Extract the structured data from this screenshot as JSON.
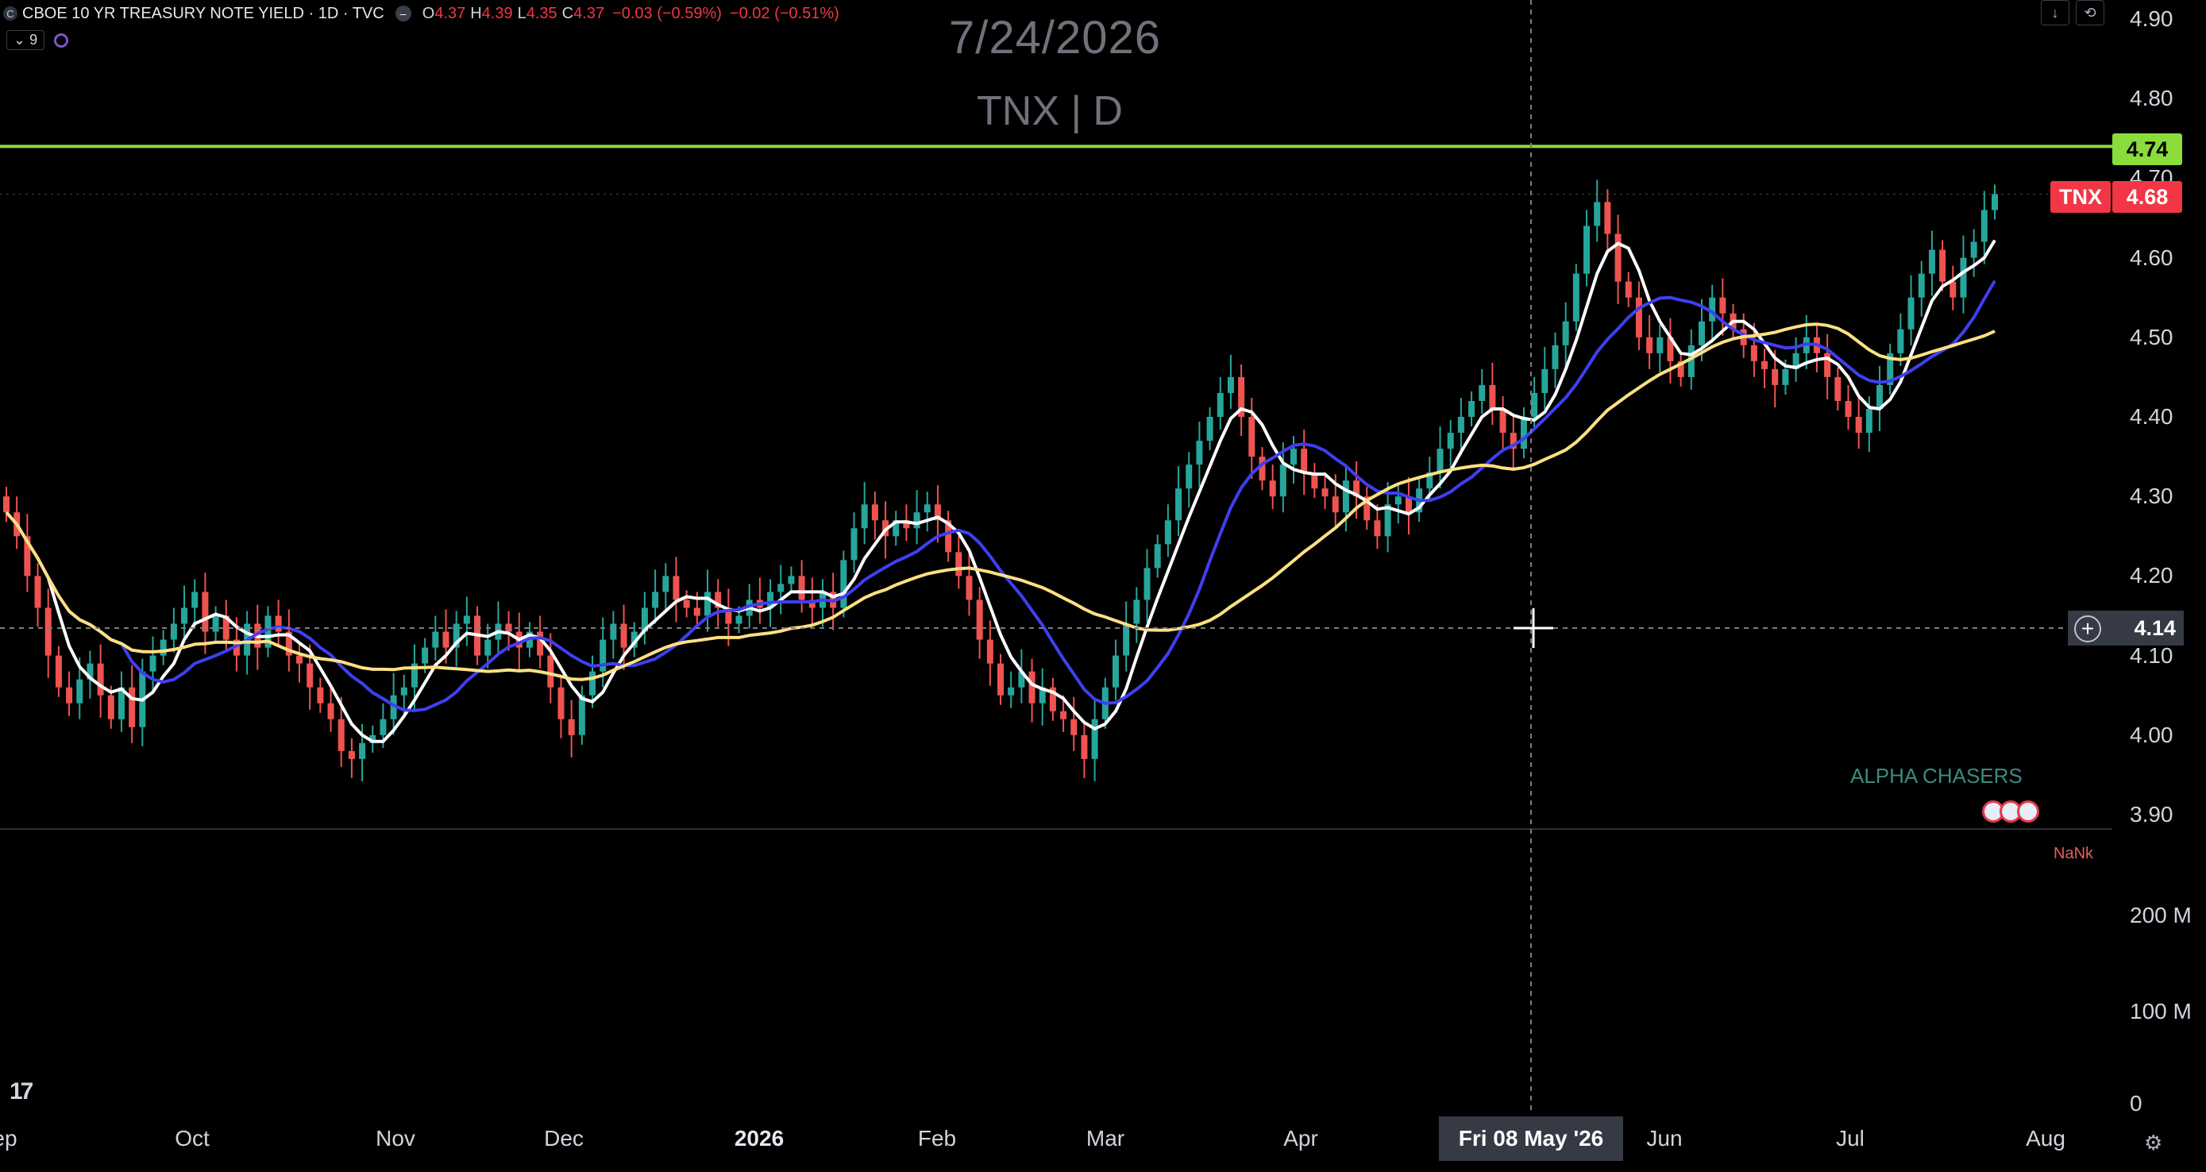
{
  "header": {
    "symbol_logo": "C",
    "symbol_title": "CBOE 10 YR TREASURY NOTE YIELD · 1D · TVC",
    "ohlc": [
      {
        "label": "O",
        "value": "4.37"
      },
      {
        "label": "H",
        "value": "4.39"
      },
      {
        "label": "L",
        "value": "4.35"
      },
      {
        "label": "C",
        "value": "4.37"
      }
    ],
    "change": "−0.03 (−0.59%)",
    "change2": "−0.02 (−0.51%)",
    "indicator_count": "9"
  },
  "watermark": {
    "date": "7/24/2026",
    "symbol": "TNX | D"
  },
  "toolbar": {
    "download_icon": "arrow-down-icon",
    "fullscreen_icon": "fullscreen-icon"
  },
  "price_axis": {
    "labels": [
      "4.90",
      "4.80",
      "4.70",
      "4.60",
      "4.50",
      "4.40",
      "4.30",
      "4.20",
      "4.10",
      "4.00",
      "3.90"
    ],
    "volume_labels": [
      "200 M",
      "100 M",
      "0"
    ]
  },
  "time_axis": {
    "labels": [
      "ep",
      "Oct",
      "Nov",
      "Dec",
      "2026",
      "Feb",
      "Mar",
      "Apr",
      "May",
      "Jun",
      "Jul",
      "Aug"
    ]
  },
  "tags": {
    "level_value": "4.74",
    "level_color": "#8bdd3b",
    "ticker_label": "TNX",
    "ticker_value": "4.68",
    "ticker_color": "#f23645"
  },
  "crosshair": {
    "date": "Fri 08 May '26",
    "price": "4.14"
  },
  "branding": {
    "name": "ALPHA CHASERS",
    "nank": "NaNk"
  },
  "colors": {
    "up": "#26a69a",
    "down": "#ef5350",
    "ma_fast": "#ffffff",
    "ma_mid": "#3f3ff0",
    "ma_slow": "#ffe082"
  },
  "chart_data": {
    "type": "candlestick",
    "y_range": [
      3.9,
      4.9
    ],
    "level_line": 4.74,
    "closes": [
      4.28,
      4.25,
      4.2,
      4.16,
      4.1,
      4.06,
      4.04,
      4.07,
      4.09,
      4.05,
      4.02,
      4.06,
      4.01,
      4.08,
      4.1,
      4.12,
      4.14,
      4.16,
      4.18,
      4.13,
      4.15,
      4.12,
      4.1,
      4.14,
      4.11,
      4.15,
      4.13,
      4.1,
      4.09,
      4.06,
      4.04,
      4.02,
      3.98,
      3.97,
      3.99,
      4.0,
      4.02,
      4.05,
      4.06,
      4.09,
      4.11,
      4.13,
      4.11,
      4.14,
      4.15,
      4.1,
      4.12,
      4.14,
      4.13,
      4.11,
      4.13,
      4.1,
      4.06,
      4.02,
      4.0,
      4.05,
      4.08,
      4.12,
      4.14,
      4.11,
      4.13,
      4.16,
      4.18,
      4.2,
      4.17,
      4.16,
      4.15,
      4.18,
      4.16,
      4.14,
      4.15,
      4.17,
      4.16,
      4.18,
      4.19,
      4.2,
      4.17,
      4.16,
      4.18,
      4.16,
      4.22,
      4.26,
      4.29,
      4.27,
      4.25,
      4.27,
      4.26,
      4.28,
      4.29,
      4.27,
      4.23,
      4.2,
      4.17,
      4.12,
      4.09,
      4.05,
      4.06,
      4.08,
      4.04,
      4.06,
      4.03,
      4.02,
      4.0,
      3.97,
      4.02,
      4.06,
      4.1,
      4.14,
      4.17,
      4.21,
      4.24,
      4.27,
      4.31,
      4.34,
      4.37,
      4.4,
      4.43,
      4.45,
      4.4,
      4.35,
      4.32,
      4.3,
      4.34,
      4.36,
      4.33,
      4.31,
      4.3,
      4.28,
      4.32,
      4.3,
      4.27,
      4.25,
      4.29,
      4.3,
      4.28,
      4.31,
      4.33,
      4.36,
      4.38,
      4.4,
      4.42,
      4.44,
      4.41,
      4.38,
      4.36,
      4.4,
      4.43,
      4.46,
      4.49,
      4.52,
      4.58,
      4.64,
      4.67,
      4.63,
      4.57,
      4.55,
      4.5,
      4.48,
      4.5,
      4.47,
      4.45,
      4.49,
      4.52,
      4.55,
      4.53,
      4.51,
      4.49,
      4.47,
      4.46,
      4.44,
      4.46,
      4.48,
      4.5,
      4.48,
      4.45,
      4.42,
      4.4,
      4.38,
      4.41,
      4.44,
      4.48,
      4.51,
      4.55,
      4.58,
      4.61,
      4.57,
      4.55,
      4.6,
      4.62,
      4.66,
      4.68
    ]
  }
}
